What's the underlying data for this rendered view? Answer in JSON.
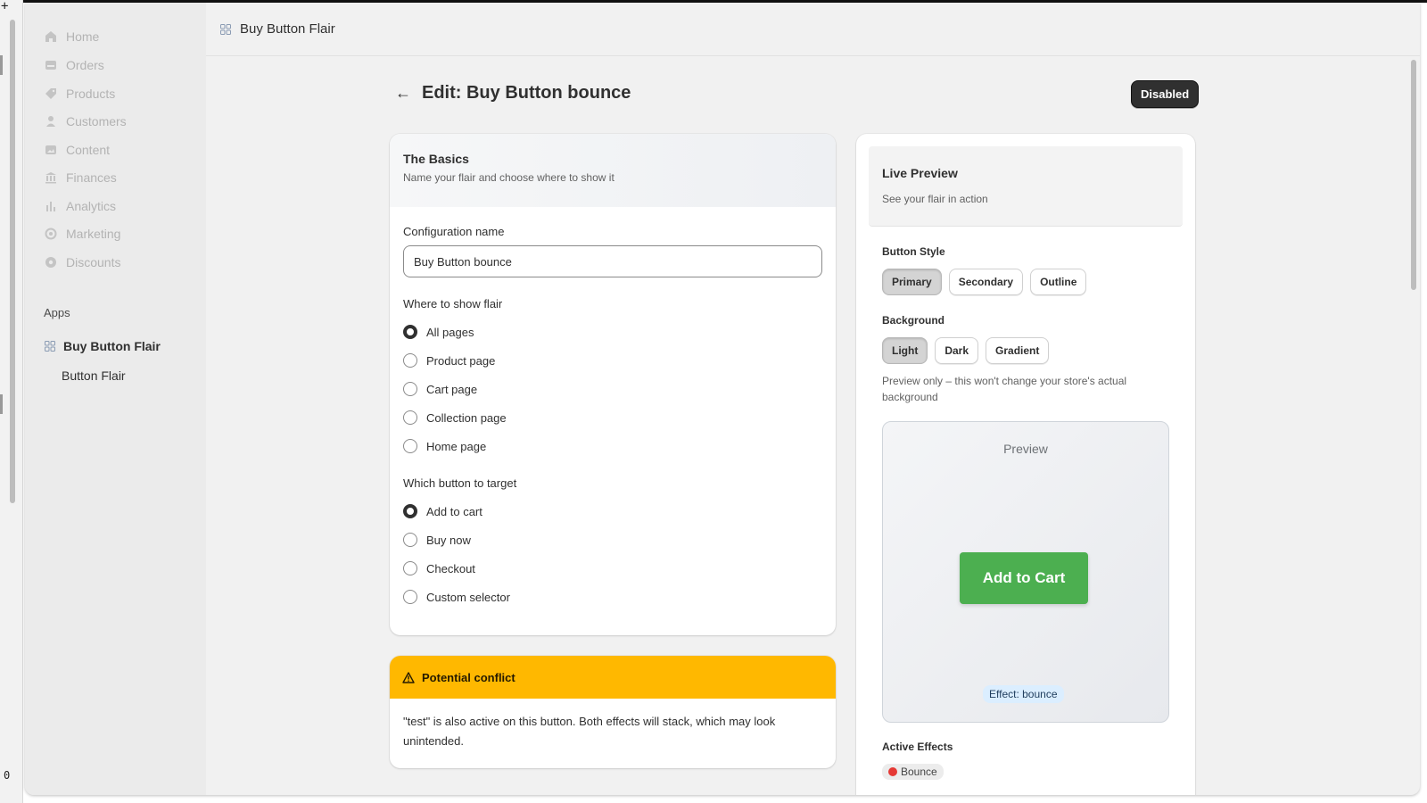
{
  "sidebar": {
    "items": [
      {
        "label": "Home",
        "icon": "home-icon"
      },
      {
        "label": "Orders",
        "icon": "inbox-icon"
      },
      {
        "label": "Products",
        "icon": "tag-icon"
      },
      {
        "label": "Customers",
        "icon": "person-icon"
      },
      {
        "label": "Content",
        "icon": "image-icon"
      },
      {
        "label": "Finances",
        "icon": "bank-icon"
      },
      {
        "label": "Analytics",
        "icon": "bar-chart-icon"
      },
      {
        "label": "Marketing",
        "icon": "target-icon"
      },
      {
        "label": "Discounts",
        "icon": "gear-badge-icon"
      }
    ],
    "apps_label": "Apps",
    "app_name": "Buy Button Flair",
    "app_sub_item": "Button Flair"
  },
  "header": {
    "title": "Buy Button Flair"
  },
  "page": {
    "title": "Edit: Buy Button bounce",
    "status_badge": "Disabled"
  },
  "basics": {
    "title": "The Basics",
    "subtitle": "Name your flair and choose where to show it",
    "config_label": "Configuration name",
    "config_value": "Buy Button bounce",
    "where_label": "Where to show flair",
    "where_options": [
      "All pages",
      "Product page",
      "Cart page",
      "Collection page",
      "Home page"
    ],
    "where_selected": "All pages",
    "target_label": "Which button to target",
    "target_options": [
      "Add to cart",
      "Buy now",
      "Checkout",
      "Custom selector"
    ],
    "target_selected": "Add to cart"
  },
  "conflict": {
    "title": "Potential conflict",
    "message": "\"test\" is also active on this button. Both effects will stack, which may look unintended."
  },
  "preview": {
    "title": "Live Preview",
    "subtitle": "See your flair in action",
    "button_style_label": "Button Style",
    "button_styles": [
      "Primary",
      "Secondary",
      "Outline"
    ],
    "button_style_selected": "Primary",
    "background_label": "Background",
    "backgrounds": [
      "Light",
      "Dark",
      "Gradient"
    ],
    "background_selected": "Light",
    "background_note": "Preview only – this won't change your store's actual background",
    "stage_title": "Preview",
    "cta_label": "Add to Cart",
    "effect_badge": "Effect: bounce",
    "active_effects_label": "Active Effects",
    "active_effects": [
      "Bounce"
    ]
  },
  "colors": {
    "accent_green": "#4caf50",
    "warning_yellow": "#ffb800",
    "badge_dark": "#303030"
  },
  "desktop_strip": {
    "bottom_text": "0"
  }
}
